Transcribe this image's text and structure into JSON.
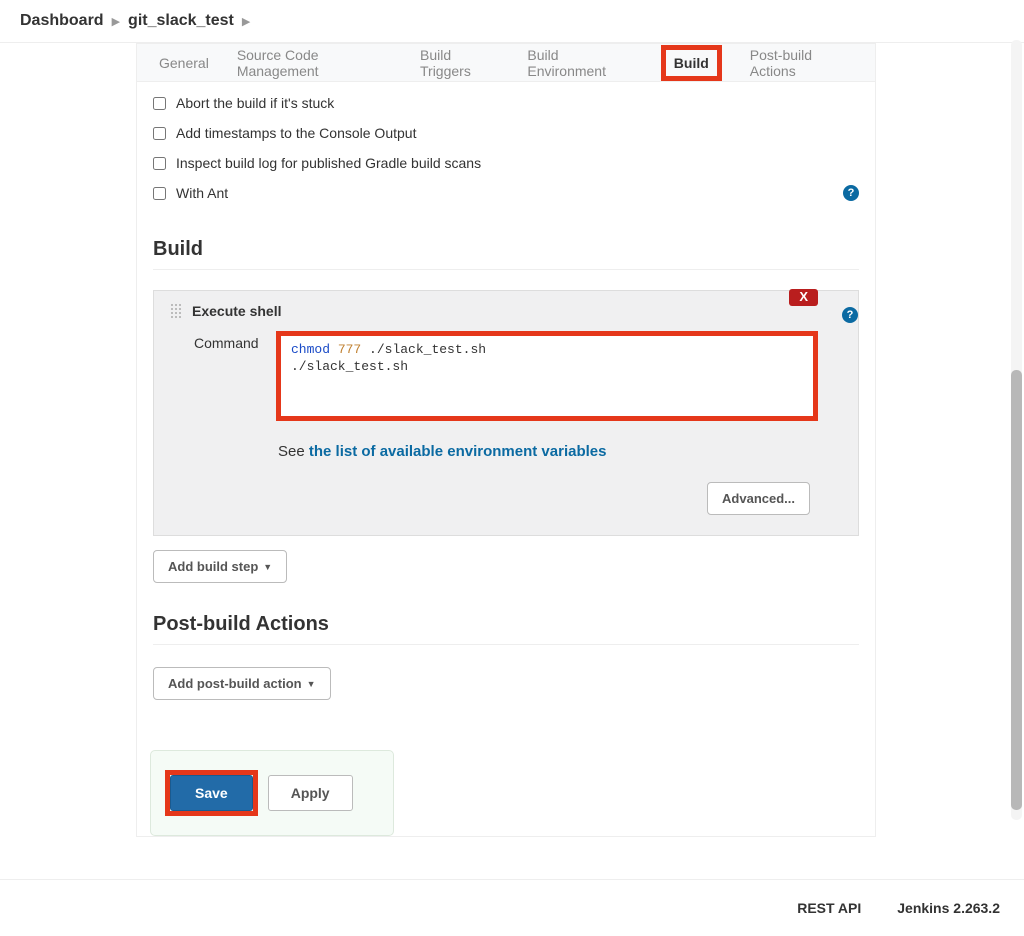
{
  "breadcrumb": {
    "items": [
      "Dashboard",
      "git_slack_test"
    ]
  },
  "tabs": {
    "general": "General",
    "scm": "Source Code Management",
    "triggers": "Build Triggers",
    "env": "Build Environment",
    "build": "Build",
    "post": "Post-build Actions"
  },
  "checkboxes": {
    "abort": "Abort the build if it's stuck",
    "timestamps": "Add timestamps to the Console Output",
    "gradle": "Inspect build log for published Gradle build scans",
    "ant": "With Ant"
  },
  "sections": {
    "build": "Build",
    "postBuild": "Post-build Actions"
  },
  "executeShell": {
    "title": "Execute shell",
    "commandLabel": "Command",
    "deleteLabel": "X",
    "command": {
      "chmod": "chmod",
      "perm": "777",
      "file1": " ./slack_test.sh",
      "line2": "./slack_test.sh"
    },
    "seeText": "See ",
    "envLink": "the list of available environment variables",
    "advancedBtn": "Advanced..."
  },
  "buttons": {
    "addBuildStep": "Add build step",
    "addPostBuild": "Add post-build action",
    "save": "Save",
    "apply": "Apply"
  },
  "footer": {
    "restApi": "REST API",
    "version": "Jenkins 2.263.2"
  }
}
